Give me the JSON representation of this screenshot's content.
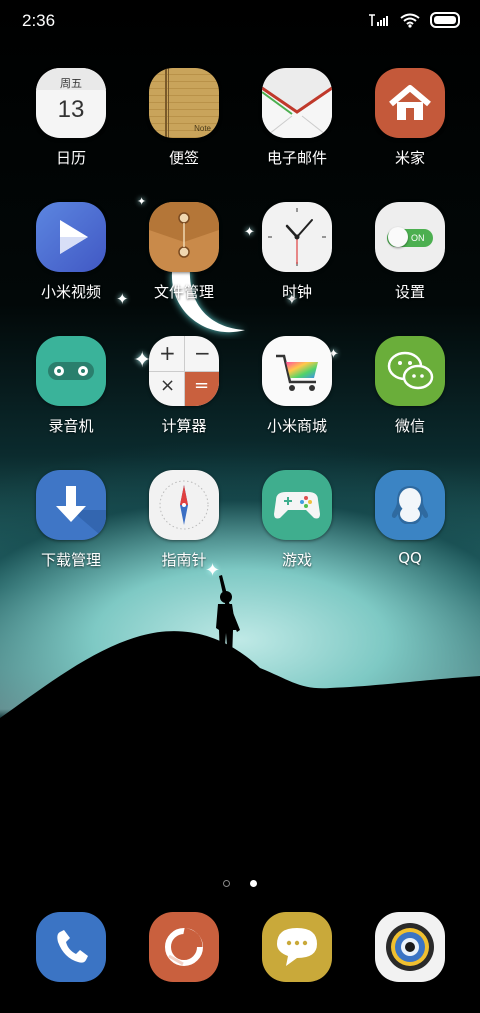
{
  "status_bar": {
    "time": "2:36"
  },
  "apps": [
    {
      "id": "calendar",
      "label": "日历",
      "weekday": "周五",
      "day": "13"
    },
    {
      "id": "notes",
      "label": "便签",
      "note_text": "Note"
    },
    {
      "id": "email",
      "label": "电子邮件"
    },
    {
      "id": "mihome",
      "label": "米家"
    },
    {
      "id": "mivideo",
      "label": "小米视频"
    },
    {
      "id": "files",
      "label": "文件管理"
    },
    {
      "id": "clock",
      "label": "时钟"
    },
    {
      "id": "settings",
      "label": "设置",
      "toggle_text": "ON"
    },
    {
      "id": "recorder",
      "label": "录音机"
    },
    {
      "id": "calculator",
      "label": "计算器"
    },
    {
      "id": "mistore",
      "label": "小米商城"
    },
    {
      "id": "wechat",
      "label": "微信"
    },
    {
      "id": "downloads",
      "label": "下载管理"
    },
    {
      "id": "compass",
      "label": "指南针"
    },
    {
      "id": "games",
      "label": "游戏"
    },
    {
      "id": "qq",
      "label": "QQ"
    }
  ],
  "pager": {
    "pages": 2,
    "current": 2
  },
  "dock": [
    "phone",
    "browser",
    "messages",
    "camera"
  ],
  "colors": {
    "calendar_bg": "#f4f4f4",
    "notes_bg": "#c9a45b",
    "email_bg": "#ececec",
    "mihome_bg": "#c4593a",
    "mivideo_bg": "#4b6fd0",
    "files_bg": "#c98a4a",
    "clock_bg": "#f2f2f2",
    "settings_bg": "#eeeeee",
    "recorder_bg": "#3ab39a",
    "calculator_bg": "#f5f5f5",
    "mistore_bg": "#fafafa",
    "wechat_bg": "#6aae3a",
    "downloads_bg": "#3f76c6",
    "compass_bg": "#f2f2f2",
    "games_bg": "#3fae8e",
    "qq_bg": "#3b84c4",
    "phone_bg": "#3b74c4",
    "browser_bg": "#c9603e",
    "messages_bg": "#c9a93a",
    "camera_bg": "#f2f2f2"
  }
}
